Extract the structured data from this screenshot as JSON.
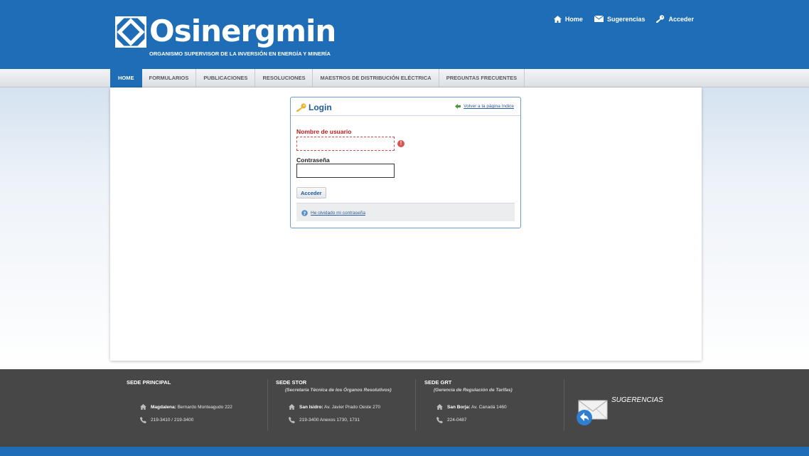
{
  "header": {
    "logo_text": "Osinergmin",
    "tagline": "ORGANISMO SUPERVISOR DE LA INVERSIÓN EN ENERGÍA Y MINERÍA",
    "links": [
      {
        "label": "Home",
        "icon": "home-icon"
      },
      {
        "label": "Sugerencias",
        "icon": "mail-icon"
      },
      {
        "label": "Acceder",
        "icon": "key-icon"
      }
    ]
  },
  "nav": {
    "items": [
      "HOME",
      "FORMULARIOS",
      "PUBLICACIONES",
      "RESOLUCIONES",
      "MAESTROS DE DISTRIBUCIÓN ELÉCTRICA",
      "PREGUNTAS FRECUENTES"
    ],
    "active": "HOME"
  },
  "login": {
    "title": "Login",
    "back_link": "Volver a la página índice",
    "username_label": "Nombre de usuario",
    "username_value": "",
    "password_label": "Contraseña",
    "password_value": "",
    "submit_label": "Acceder",
    "forgot_link": "He olvidado mi contraseña"
  },
  "footer": {
    "sedes": [
      {
        "title": "SEDE PRINCIPAL",
        "subtitle": "",
        "place": "Magdalena:",
        "address": "Bernardo Monteagudo 222",
        "phone": "219-3410 / 219-3400"
      },
      {
        "title": "SEDE STOR",
        "subtitle": "(Secretaría Técnica de los Órganos Resolutivos)",
        "place": "San Isidro:",
        "address": "Av. Javier Prado Oeste 270",
        "phone": "219-3400 Anexos 1730, 1731"
      },
      {
        "title": "SEDE GRT",
        "subtitle": "(Gerencia de Regulación de Tarifas)",
        "place": "San Borja:",
        "address": "Av. Canadá 1460",
        "phone": "224-0487"
      }
    ],
    "suggestions_label": "SUGERENCIAS"
  },
  "colors": {
    "brand_blue": "#1e6db6",
    "footer_gray": "#474747",
    "error_red": "#b52020"
  }
}
